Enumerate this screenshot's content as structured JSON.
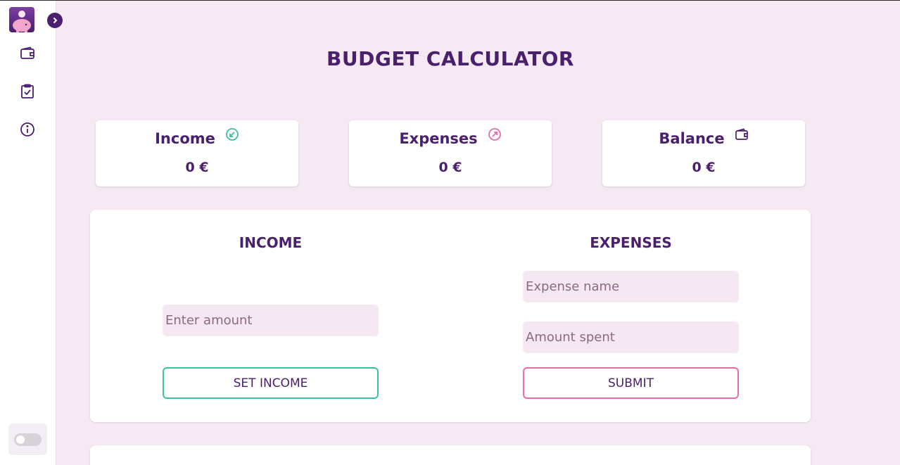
{
  "page_title": "BUDGET CALCULATOR",
  "summary": {
    "income": {
      "label": "Income",
      "value": "0",
      "currency": "€"
    },
    "expenses": {
      "label": "Expenses",
      "value": "0",
      "currency": "€"
    },
    "balance": {
      "label": "Balance",
      "value": "0",
      "currency": "€"
    }
  },
  "income_form": {
    "title": "INCOME",
    "amount_placeholder": "Enter amount",
    "button_label": "SET INCOME"
  },
  "expense_form": {
    "title": "EXPENSES",
    "name_placeholder": "Expense name",
    "amount_placeholder": "Amount spent",
    "button_label": "SUBMIT"
  },
  "colors": {
    "primary": "#4a1f6e",
    "background": "#f5e9f3",
    "income_accent": "#3dbfa2",
    "expense_accent": "#e96ba8"
  },
  "icons": {
    "logo": "piggy-bank-icon",
    "collapse": "chevron-right-icon",
    "nav": [
      "wallet-icon",
      "clipboard-check-icon",
      "info-icon"
    ],
    "income_card": "arrow-down-left-circle-icon",
    "expenses_card": "arrow-up-right-circle-icon",
    "balance_card": "wallet-icon"
  }
}
